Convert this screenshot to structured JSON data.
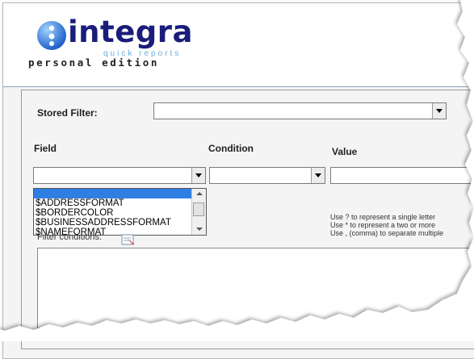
{
  "logo": {
    "name": "integra",
    "tagline": "quick reports",
    "edition": "personal edition"
  },
  "filter": {
    "stored_filter_label": "Stored Filter:",
    "stored_filter_value": "",
    "field_label": "Field",
    "condition_label": "Condition",
    "value_label": "Value",
    "field_value": "",
    "condition_value": "",
    "value_text": ""
  },
  "field_dropdown": {
    "items": [
      "",
      "$ADDRESSFORMAT",
      "$BORDERCOLOR",
      "$BUSINESSADDRESSFORMAT",
      "$NAMEFORMAT"
    ],
    "selected_index": 0
  },
  "hints": [
    "Use ? to represent a single letter",
    "Use * to represent a two or more",
    "Use , (comma) to separate multiple"
  ],
  "filter_conditions_label": "Filter conditions:",
  "colors": {
    "brand_dark": "#1a1d7a",
    "brand_light": "#6aaee3",
    "selection": "#2f7fe3"
  }
}
